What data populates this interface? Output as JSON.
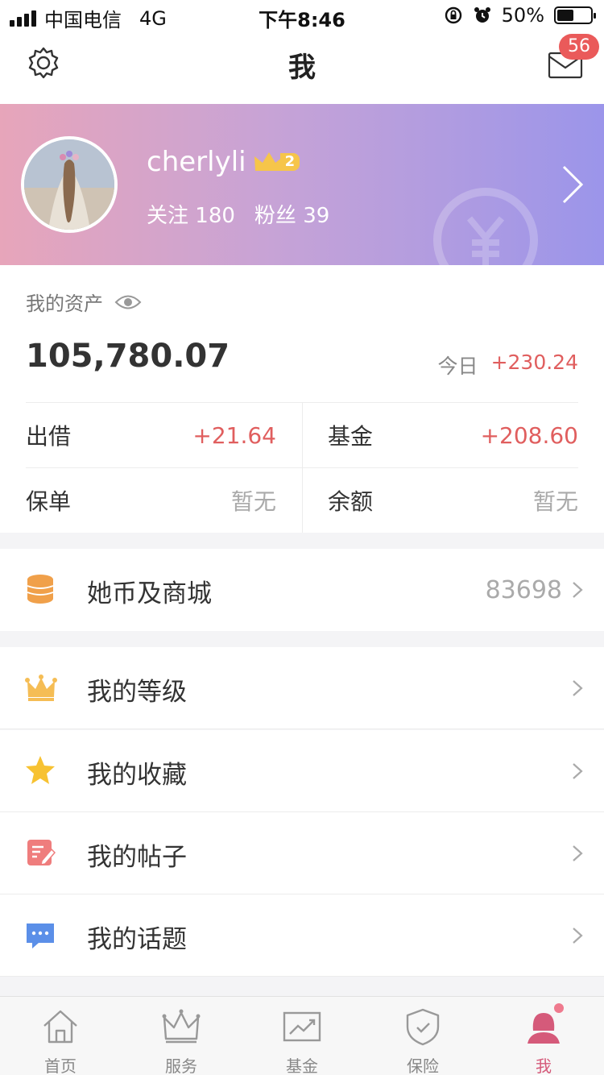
{
  "status_bar": {
    "carrier": "中国电信",
    "network": "4G",
    "time": "下午8:46",
    "battery": "50%",
    "battery_level": 0.5
  },
  "nav": {
    "title": "我",
    "message_badge": "56",
    "icons": [
      "gear-icon",
      "mail-icon"
    ]
  },
  "profile": {
    "username": "cherlyli",
    "level_badge": "2",
    "following_label": "关注",
    "following_count": "180",
    "fans_label": "粉丝",
    "fans_count": "39"
  },
  "assets": {
    "label": "我的资产",
    "total": "105,780.07",
    "today_label": "今日",
    "today_change": "+230.24",
    "items": [
      {
        "label": "出借",
        "value": "+21.64"
      },
      {
        "label": "基金",
        "value": "+208.60"
      },
      {
        "label": "保单",
        "value": "暂无"
      },
      {
        "label": "余额",
        "value": "暂无"
      }
    ]
  },
  "coin_row": {
    "label": "她币及商城",
    "value": "83698"
  },
  "menu": [
    {
      "label": "我的等级",
      "icon": "crown-icon"
    },
    {
      "label": "我的收藏",
      "icon": "star-icon"
    },
    {
      "label": "我的帖子",
      "icon": "edit-note-icon"
    },
    {
      "label": "我的话题",
      "icon": "chat-bubble-icon"
    }
  ],
  "tabs": [
    {
      "label": "首页",
      "icon": "home-icon"
    },
    {
      "label": "服务",
      "icon": "crown-outline-icon"
    },
    {
      "label": "基金",
      "icon": "chart-icon"
    },
    {
      "label": "保险",
      "icon": "shield-icon"
    },
    {
      "label": "我",
      "icon": "user-icon"
    }
  ],
  "colors": {
    "positive": "#e05e5e",
    "accent": "#d55a7a",
    "banner_start": "#e7a5ba",
    "banner_end": "#9b95ea"
  }
}
